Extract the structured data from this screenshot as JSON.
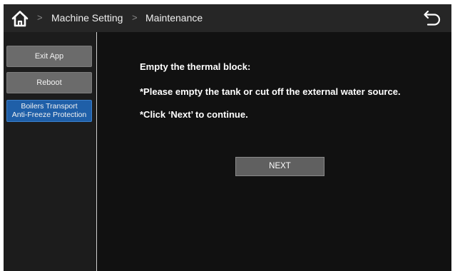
{
  "header": {
    "breadcrumb": [
      "Machine Setting",
      "Maintenance"
    ],
    "separator": ">",
    "home_icon": "home-icon",
    "back_icon": "back-arrow-icon"
  },
  "sidebar": {
    "items": [
      {
        "label": "Exit App",
        "active": false
      },
      {
        "label": "Reboot",
        "active": false
      },
      {
        "label_line1": "Boilers Transport",
        "label_line2": "Anti-Freeze Protection",
        "active": true
      }
    ]
  },
  "main": {
    "title": "Empty the thermal block:",
    "instruction1": "*Please empty the tank or cut off the external water source.",
    "instruction2": "*Click ‘Next’ to continue.",
    "next_label": "NEXT"
  },
  "colors": {
    "background": "#111111",
    "topbar": "#262626",
    "active_item": "#1f5fa8",
    "button_grey": "#6b6b6b"
  }
}
